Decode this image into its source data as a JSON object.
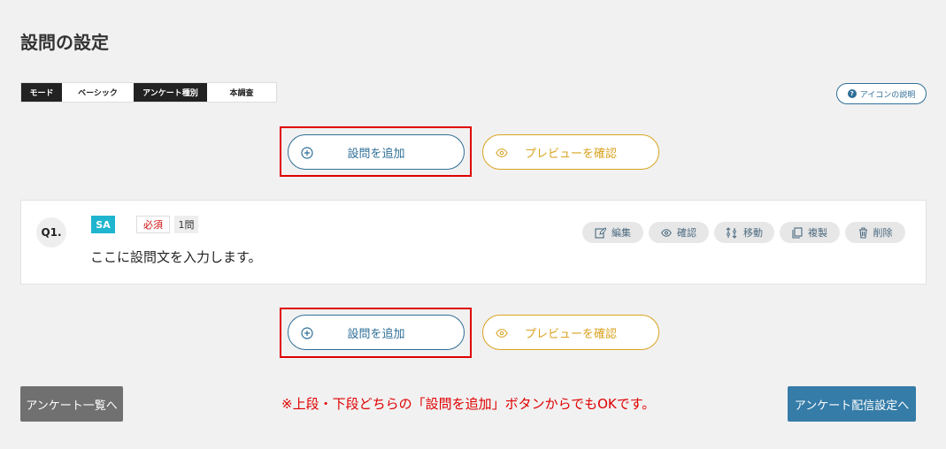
{
  "page": {
    "title": "設問の設定"
  },
  "mode_table": {
    "cells": [
      {
        "label": "モード",
        "style": "dark"
      },
      {
        "label": "ベーシック",
        "style": "light"
      },
      {
        "label": "アンケート種別",
        "style": "dark"
      },
      {
        "label": "本調査",
        "style": "light"
      }
    ]
  },
  "icon_help_button": {
    "label": "アイコンの説明",
    "icon": "question-circle-icon"
  },
  "actions": {
    "add_label": "設問を追加",
    "add_icon": "plus-circle-icon",
    "preview_label": "プレビューを確認",
    "preview_icon": "eye-icon"
  },
  "question": {
    "number": "Q1.",
    "type": "SA",
    "required": "必須",
    "count": "1問",
    "text": "ここに設問文を入力します。",
    "tools": [
      {
        "label": "編集",
        "icon": "edit-icon"
      },
      {
        "label": "確認",
        "icon": "eye-icon"
      },
      {
        "label": "移動",
        "icon": "move-icon"
      },
      {
        "label": "複製",
        "icon": "copy-icon"
      },
      {
        "label": "削除",
        "icon": "trash-icon"
      }
    ]
  },
  "footer": {
    "back_label": "アンケート一覧へ",
    "note": "※上段・下段どちらの「設問を追加」ボタンからでもOKです。",
    "deliver_label": "アンケート配信設定へ"
  },
  "colors": {
    "primary": "#2f6f97",
    "preview": "#d9a320",
    "highlight": "#e00000",
    "sa_badge": "#1fb5cf",
    "deliver_button": "#357ca8",
    "back_button": "#707070"
  }
}
